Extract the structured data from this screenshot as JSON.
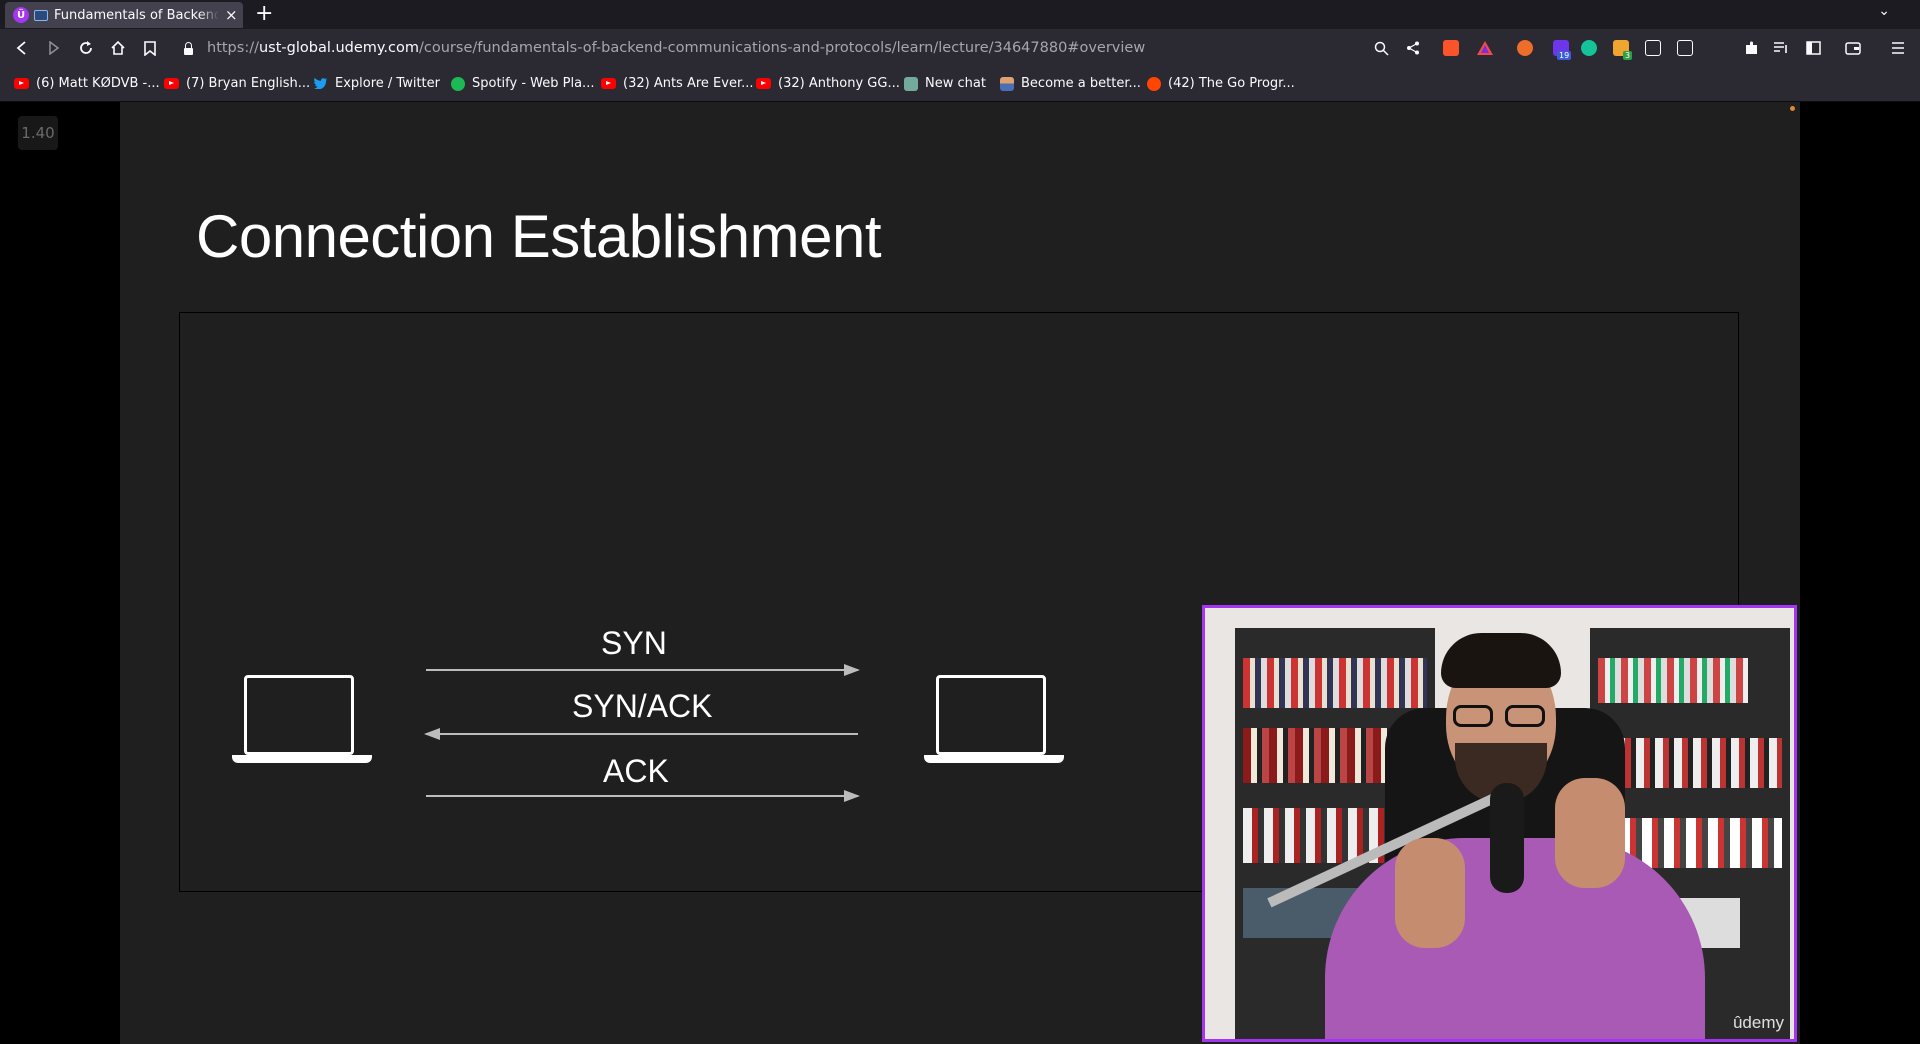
{
  "browser": {
    "tab": {
      "title": "Fundamentals of Backend E",
      "close": "×"
    },
    "new_tab": "+",
    "tab_list": "⌄",
    "url": {
      "scheme": "https://",
      "domain": "ust-global.udemy.com",
      "path": "/course/fundamentals-of-backend-communications-and-protocols/learn/lecture/34647880#overview"
    },
    "extension_badges": {
      "ext1": "19",
      "ext2": "3"
    },
    "bookmarks": [
      {
        "label": "(6) Matt KØDVB -...",
        "icon": "youtube-icon"
      },
      {
        "label": "(7) Bryan English...",
        "icon": "youtube-icon"
      },
      {
        "label": "Explore / Twitter",
        "icon": "twitter-icon"
      },
      {
        "label": "Spotify - Web Pla...",
        "icon": "spotify-icon"
      },
      {
        "label": "(32) Ants Are Ever...",
        "icon": "youtube-icon"
      },
      {
        "label": "(32) Anthony GG...",
        "icon": "youtube-icon"
      },
      {
        "label": "New chat",
        "icon": "chatgpt-icon"
      },
      {
        "label": "Become a better...",
        "icon": "person-icon"
      },
      {
        "label": "(42) The Go Progr...",
        "icon": "reddit-icon"
      }
    ],
    "colors": {
      "udemy_purple": "#a435f0",
      "tab_bg": "#42414d",
      "toolbar_bg": "#2b2a33"
    }
  },
  "video": {
    "speed": "1.40",
    "slide": {
      "title": "Connection Establishment",
      "messages": [
        "SYN",
        "SYN/ACK",
        "ACK"
      ]
    },
    "watermark": "ûdemy"
  }
}
